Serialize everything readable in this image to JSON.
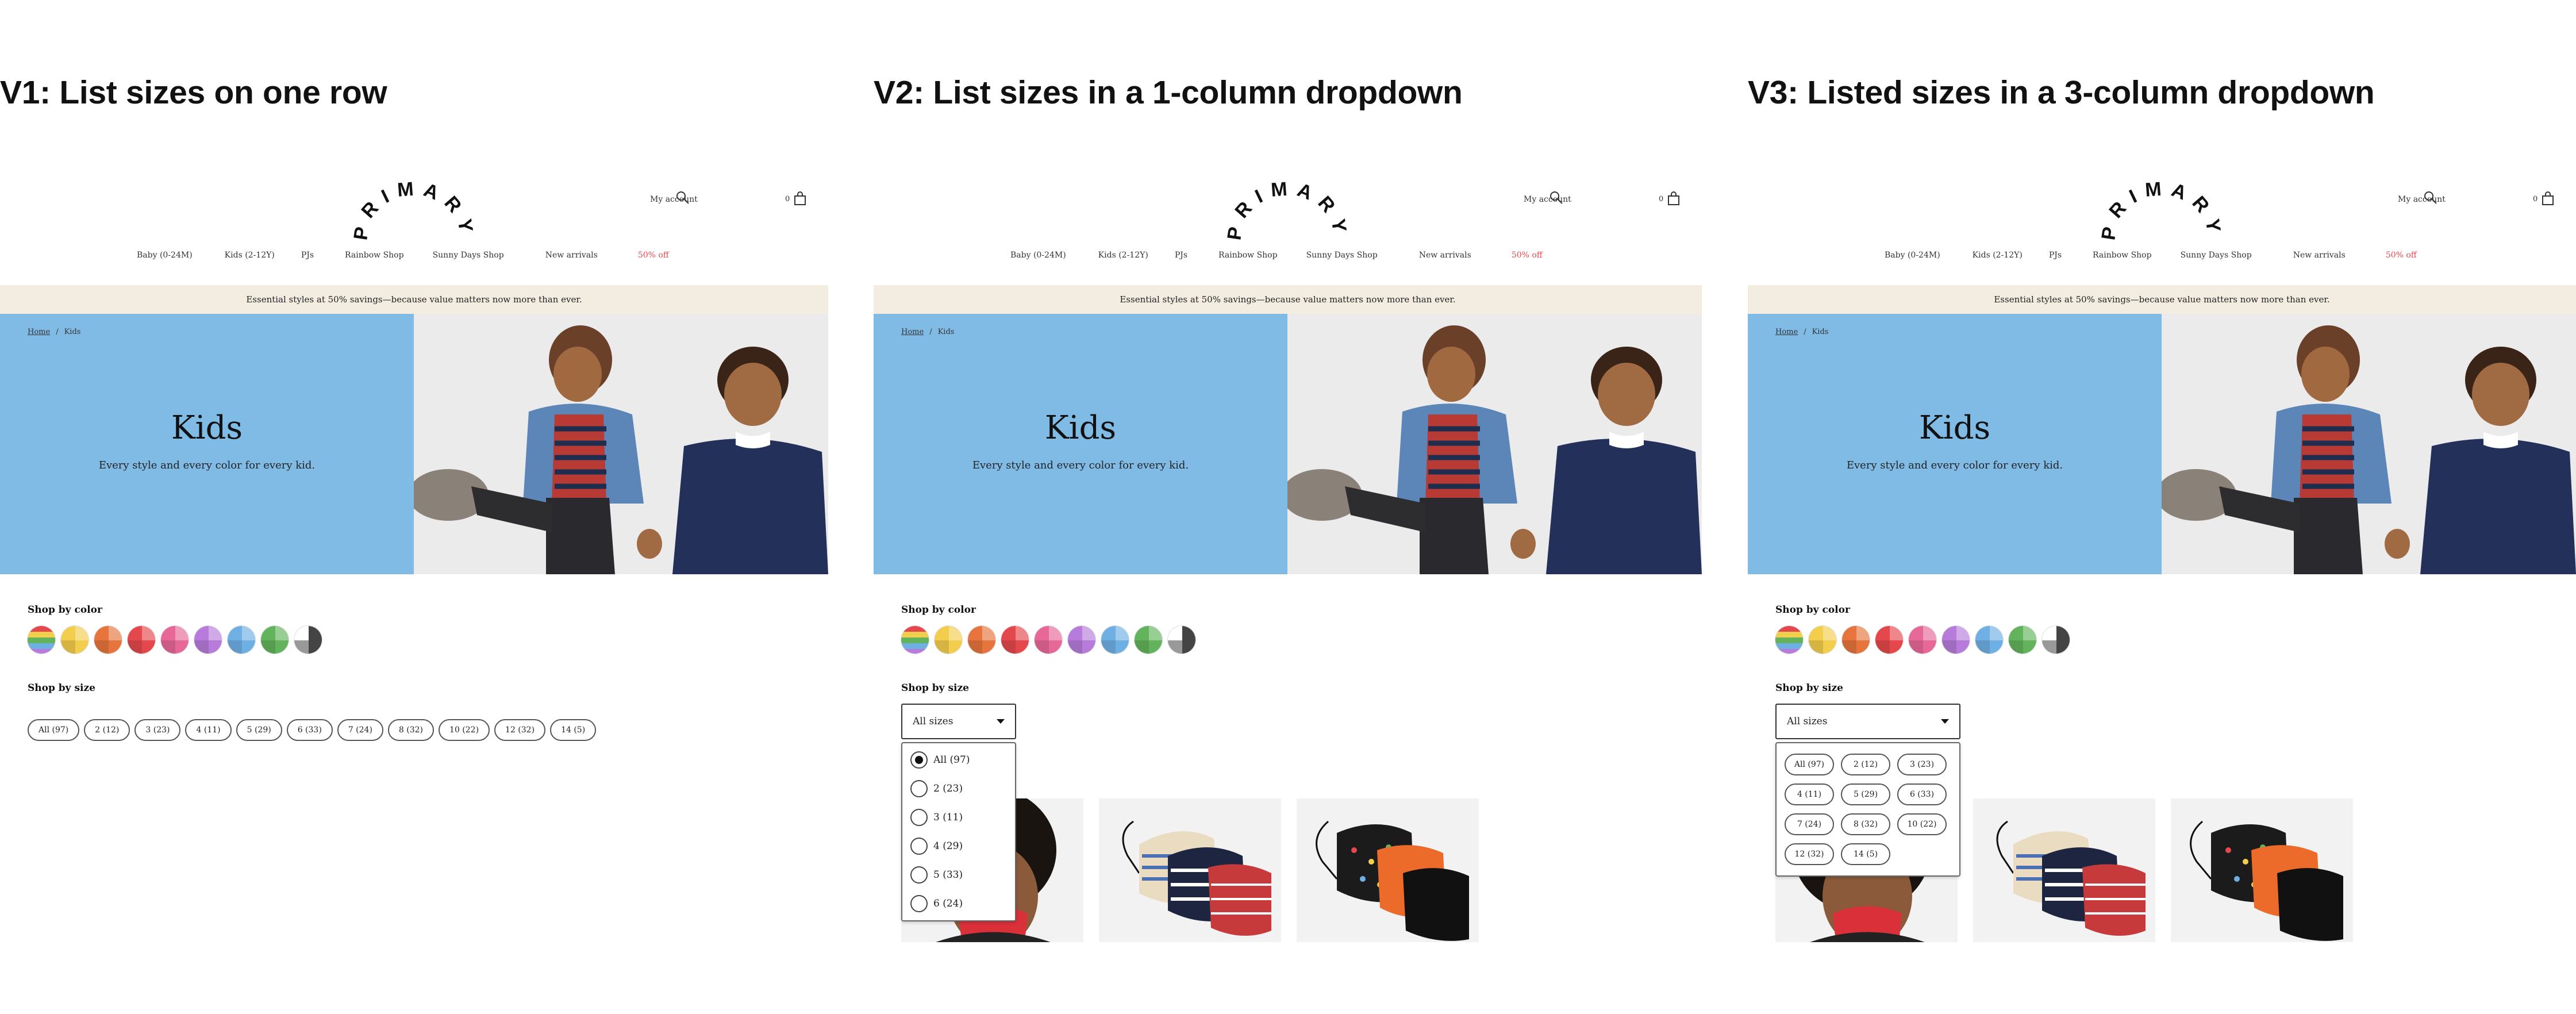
{
  "variants": [
    {
      "title": "V1: List sizes on one row"
    },
    {
      "title": "V2: List sizes in a 1-column dropdown"
    },
    {
      "title": "V3: Listed sizes in a 3-column dropdown"
    }
  ],
  "header": {
    "logo": "PRIMARY",
    "account": "My account",
    "cart_count": "0",
    "icons": [
      "search-icon",
      "cart-icon"
    ]
  },
  "nav": [
    {
      "label": "Baby (0-24M)",
      "sale": false
    },
    {
      "label": "Kids (2-12Y)",
      "sale": false
    },
    {
      "label": "PJs",
      "sale": false
    },
    {
      "label": "Rainbow Shop",
      "sale": false
    },
    {
      "label": "Sunny Days Shop",
      "sale": false
    },
    {
      "label": "New arrivals",
      "sale": false
    },
    {
      "label": "50% off",
      "sale": true
    }
  ],
  "promo": "Essential styles at 50% savings—because value matters now more than ever.",
  "breadcrumb": {
    "home": "Home",
    "separator": "/",
    "current": "Kids"
  },
  "hero": {
    "title": "Kids",
    "subtitle": "Every style and every color for every kid.",
    "bg_color": "#80bbe6"
  },
  "shop_by_color": {
    "label": "Shop by color",
    "swatches": [
      {
        "name": "rainbow"
      },
      {
        "name": "yellow",
        "color": "#f3cd4c"
      },
      {
        "name": "orange",
        "color": "#e6743c"
      },
      {
        "name": "red",
        "color": "#e4484c"
      },
      {
        "name": "pink",
        "color": "#e76797"
      },
      {
        "name": "purple",
        "color": "#b77bdb"
      },
      {
        "name": "blue",
        "color": "#6fb0e4"
      },
      {
        "name": "green",
        "color": "#62b35b"
      },
      {
        "name": "black-white",
        "color": "#444444"
      }
    ]
  },
  "shop_by_size": {
    "label": "Shop by size",
    "select_value": "All sizes",
    "options": [
      "All (97)",
      "2 (12)",
      "3 (23)",
      "4 (11)",
      "5 (29)",
      "6 (33)",
      "7 (24)",
      "8 (32)",
      "10 (22)",
      "12 (32)",
      "14 (5)"
    ],
    "v2_visible_options": [
      "All (97)",
      "2 (23)",
      "3 (11)",
      "4 (29)",
      "5 (33)",
      "6 (24)"
    ],
    "v2_selected_index": 0
  },
  "products": [
    {
      "name": "red-face-mask-kid"
    },
    {
      "name": "striped-face-masks"
    },
    {
      "name": "patterned-face-masks"
    }
  ]
}
